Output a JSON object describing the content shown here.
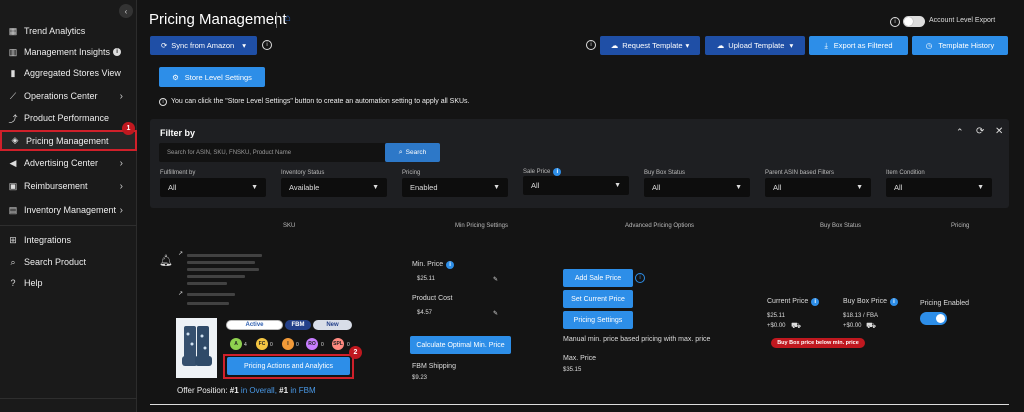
{
  "sidebar": {
    "items": [
      {
        "label": "Trend Analytics",
        "icon": "trend-icon"
      },
      {
        "label": "Management Insights",
        "icon": "insights-icon"
      },
      {
        "label": "Aggregated Stores View",
        "icon": "bar-chart-icon"
      },
      {
        "label": "Operations Center",
        "icon": "operations-icon"
      },
      {
        "label": "Product Performance",
        "icon": "performance-icon"
      },
      {
        "label": "Pricing Management",
        "icon": "tag-icon"
      },
      {
        "label": "Advertising Center",
        "icon": "megaphone-icon"
      },
      {
        "label": "Reimbursement",
        "icon": "reimbursement-icon"
      },
      {
        "label": "Inventory Management",
        "icon": "inventory-icon"
      },
      {
        "label": "Integrations",
        "icon": "integrations-icon"
      },
      {
        "label": "Search Product",
        "icon": "search-icon"
      },
      {
        "label": "Help",
        "icon": "help-icon"
      }
    ],
    "marker1": "1"
  },
  "header": {
    "title": "Pricing Management",
    "account_export_label": "Account Level Export",
    "sync_label": "Sync from Amazon",
    "request_template": "Request Template",
    "upload_template": "Upload Template",
    "export_filtered": "Export as Filtered",
    "template_history": "Template History",
    "store_level_settings": "Store Level Settings",
    "info_text": "You can click the \"Store Level Settings\" button to create an automation setting to apply all SKUs."
  },
  "filter": {
    "title": "Filter by",
    "search_placeholder": "Search for ASIN, SKU, FNSKU, Product Name",
    "search_button": "Search",
    "fields": [
      {
        "label": "Fulfillment by",
        "value": "All"
      },
      {
        "label": "Inventory Status",
        "value": "Available"
      },
      {
        "label": "Pricing",
        "value": "Enabled"
      },
      {
        "label": "Sale Price",
        "value": "All"
      },
      {
        "label": "Buy Box Status",
        "value": "All"
      },
      {
        "label": "Parent ASIN based Filters",
        "value": "All"
      },
      {
        "label": "Item Condition",
        "value": "All"
      }
    ]
  },
  "table": {
    "headers": [
      "SKU",
      "Min Pricing Settings",
      "Advanced Pricing Options",
      "Buy Box Status",
      "Pricing"
    ],
    "row": {
      "status_active": "Active",
      "status_fbm": "FBM",
      "status_new": "New",
      "metrics": [
        {
          "key": "A",
          "count": "4",
          "color": "#8fd14f"
        },
        {
          "key": "FC",
          "count": "0",
          "color": "#f4c542"
        },
        {
          "key": "I",
          "count": "0",
          "color": "#f29a38"
        },
        {
          "key": "RO",
          "count": "0",
          "color": "#c77dff"
        },
        {
          "key": "SPL",
          "count": "0",
          "color": "#ff8a80"
        }
      ],
      "pricing_actions": "Pricing Actions and Analytics",
      "marker2": "2",
      "offer_prefix": "Offer Position:",
      "offer_rank1": "#1",
      "offer_in_overall": "in Overall,",
      "offer_rank2": "#1",
      "offer_in_fbm": "in FBM",
      "min_price_label": "Min. Price",
      "min_price_value": "$25.11",
      "product_cost_label": "Product Cost",
      "product_cost_value": "$4.57",
      "calc_button": "Calculate Optimal Min. Price",
      "fbm_shipping_label": "FBM Shipping",
      "fbm_shipping_value": "$9.23",
      "add_sale_price": "Add Sale Price",
      "set_current_price": "Set Current Price",
      "pricing_settings": "Pricing Settings",
      "manual_text": "Manual min. price based pricing with max. price",
      "max_price_label": "Max. Price",
      "max_price_value": "$35.15",
      "current_price_label": "Current Price",
      "current_price_value": "$25.11",
      "current_shipping": "+$0.00",
      "buybox_price_label": "Buy Box Price",
      "buybox_price_value": "$18.13",
      "buybox_fba": "/ FBA",
      "buybox_shipping": "+$0.00",
      "buybox_warning": "Buy Box price below min. price",
      "pricing_enabled_label": "Pricing Enabled"
    }
  }
}
